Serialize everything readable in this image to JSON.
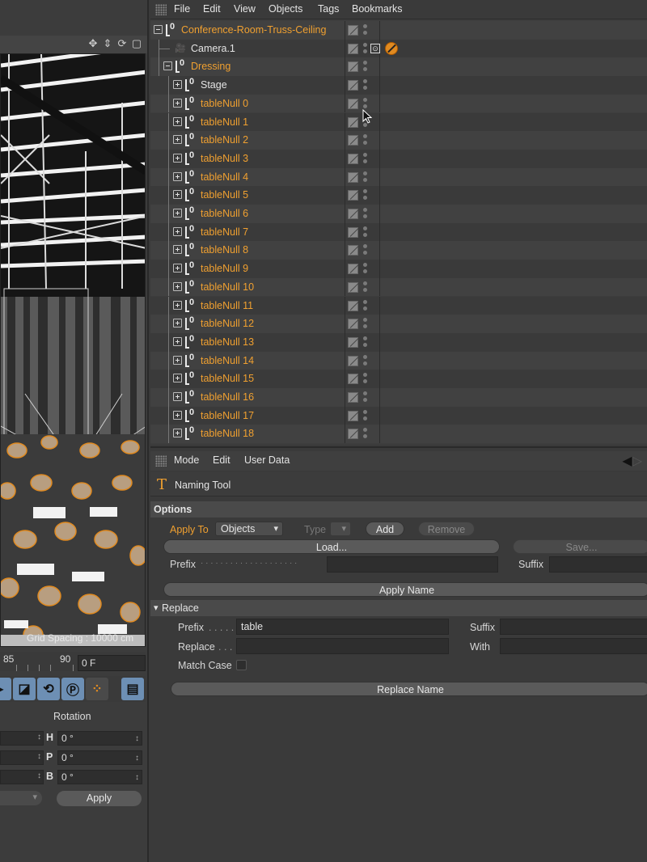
{
  "viewport": {
    "grid_spacing": "Grid Spacing : 10000 cm",
    "toolbar_icons": [
      "move-view-icon",
      "pan-view-icon",
      "rotate-view-icon",
      "maximize-view-icon"
    ]
  },
  "timeline": {
    "tick_85": "85",
    "tick_90": "90",
    "frame_value": "0 F"
  },
  "coordinates": {
    "rotation_label": "Rotation",
    "rows": [
      {
        "axis": "H",
        "value": "0 °"
      },
      {
        "axis": "P",
        "value": "0 °"
      },
      {
        "axis": "B",
        "value": "0 °"
      }
    ],
    "apply_label": "Apply"
  },
  "object_manager": {
    "menu": [
      "File",
      "Edit",
      "View",
      "Objects",
      "Tags",
      "Bookmarks"
    ],
    "objects": [
      {
        "name": "Conference-Room-Truss-Ceiling",
        "color": "orange",
        "depth": 0,
        "icon": "null-icon",
        "expand": "minus"
      },
      {
        "name": "Camera.1",
        "color": "white",
        "depth": 1,
        "icon": "camera-icon",
        "expand": "none",
        "tags": [
          "target-tag-icon",
          "protection-tag-icon"
        ]
      },
      {
        "name": "Dressing",
        "color": "orange",
        "depth": 1,
        "icon": "null-icon",
        "expand": "minus"
      },
      {
        "name": "Stage",
        "color": "white",
        "depth": 2,
        "icon": "null-icon",
        "expand": "plus"
      },
      {
        "name": "tableNull 0",
        "color": "orange",
        "depth": 2,
        "icon": "null-icon",
        "expand": "plus"
      },
      {
        "name": "tableNull 1",
        "color": "orange",
        "depth": 2,
        "icon": "null-icon",
        "expand": "plus"
      },
      {
        "name": "tableNull 2",
        "color": "orange",
        "depth": 2,
        "icon": "null-icon",
        "expand": "plus"
      },
      {
        "name": "tableNull 3",
        "color": "orange",
        "depth": 2,
        "icon": "null-icon",
        "expand": "plus"
      },
      {
        "name": "tableNull 4",
        "color": "orange",
        "depth": 2,
        "icon": "null-icon",
        "expand": "plus"
      },
      {
        "name": "tableNull 5",
        "color": "orange",
        "depth": 2,
        "icon": "null-icon",
        "expand": "plus"
      },
      {
        "name": "tableNull 6",
        "color": "orange",
        "depth": 2,
        "icon": "null-icon",
        "expand": "plus"
      },
      {
        "name": "tableNull 7",
        "color": "orange",
        "depth": 2,
        "icon": "null-icon",
        "expand": "plus"
      },
      {
        "name": "tableNull 8",
        "color": "orange",
        "depth": 2,
        "icon": "null-icon",
        "expand": "plus"
      },
      {
        "name": "tableNull 9",
        "color": "orange",
        "depth": 2,
        "icon": "null-icon",
        "expand": "plus"
      },
      {
        "name": "tableNull 10",
        "color": "orange",
        "depth": 2,
        "icon": "null-icon",
        "expand": "plus"
      },
      {
        "name": "tableNull 11",
        "color": "orange",
        "depth": 2,
        "icon": "null-icon",
        "expand": "plus"
      },
      {
        "name": "tableNull 12",
        "color": "orange",
        "depth": 2,
        "icon": "null-icon",
        "expand": "plus"
      },
      {
        "name": "tableNull 13",
        "color": "orange",
        "depth": 2,
        "icon": "null-icon",
        "expand": "plus"
      },
      {
        "name": "tableNull 14",
        "color": "orange",
        "depth": 2,
        "icon": "null-icon",
        "expand": "plus"
      },
      {
        "name": "tableNull 15",
        "color": "orange",
        "depth": 2,
        "icon": "null-icon",
        "expand": "plus"
      },
      {
        "name": "tableNull 16",
        "color": "orange",
        "depth": 2,
        "icon": "null-icon",
        "expand": "plus"
      },
      {
        "name": "tableNull 17",
        "color": "orange",
        "depth": 2,
        "icon": "null-icon",
        "expand": "plus"
      },
      {
        "name": "tableNull 18",
        "color": "orange",
        "depth": 2,
        "icon": "null-icon",
        "expand": "plus"
      }
    ]
  },
  "attribute_manager": {
    "menu": [
      "Mode",
      "Edit",
      "User Data"
    ],
    "tool_name": "Naming Tool",
    "options_heading": "Options",
    "apply_to_label": "Apply To",
    "apply_to_value": "Objects",
    "type_label": "Type",
    "add_label": "Add",
    "remove_label": "Remove",
    "load_label": "Load...",
    "save_label": "Save...",
    "prefix_label": "Prefix",
    "prefix_dots": "· · · · · · · · · · · · · · · · · · · ·",
    "prefix_value": "",
    "suffix_label": "Suffix",
    "suffix_value": "",
    "apply_name_label": "Apply Name",
    "replace_heading": "Replace",
    "replace_prefix_label": "Prefix",
    "replace_prefix_dots": ". . . . .",
    "replace_prefix_value": "table",
    "replace_suffix_label": "Suffix",
    "replace_suffix_value": "",
    "replace_label": "Replace",
    "replace_dots": ". . .",
    "replace_value": "",
    "with_label": "With",
    "with_value": "",
    "match_case_label": "Match Case",
    "match_case_checked": false,
    "replace_name_label": "Replace Name"
  },
  "colors": {
    "accent_orange": "#f0a030",
    "panel_bg": "#3a3a3a",
    "tool_blue": "#6d8fb4"
  }
}
